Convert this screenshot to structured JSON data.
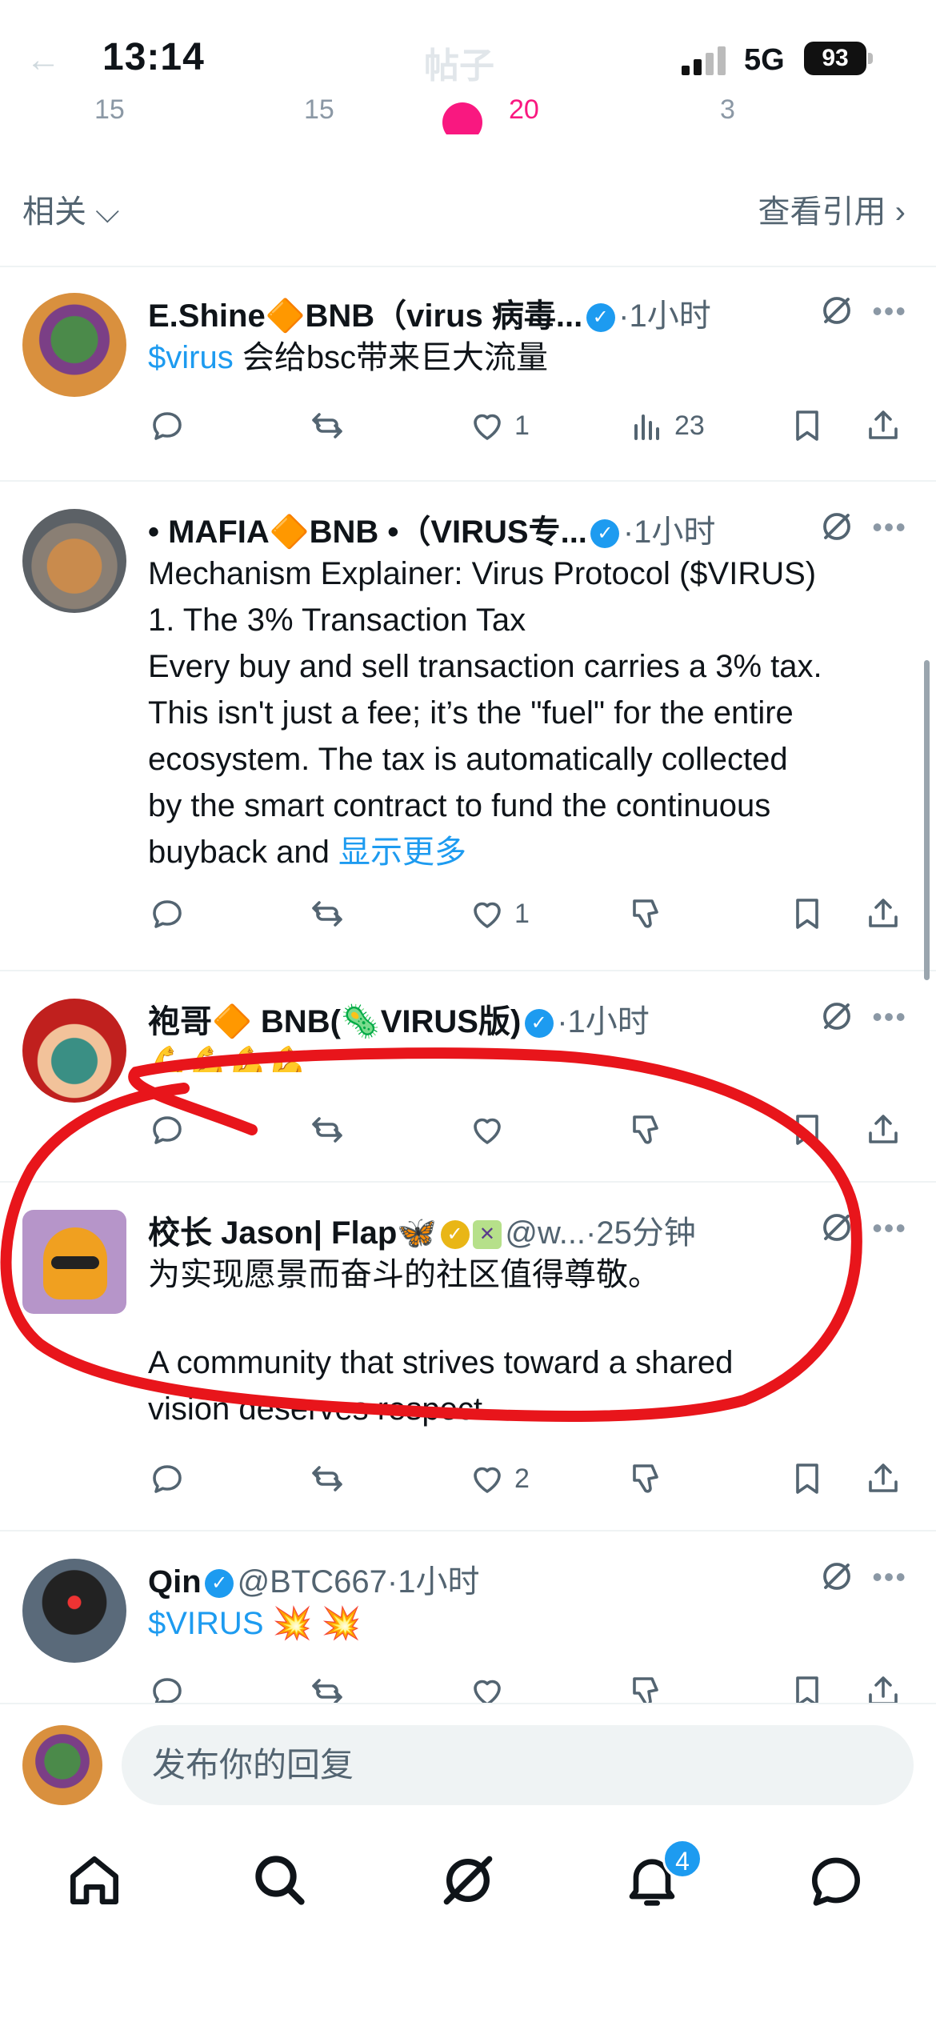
{
  "status_bar": {
    "time": "13:14",
    "network": "5G",
    "battery": "93",
    "title": "帖子",
    "back": "←"
  },
  "prev_actions": {
    "replies": "15",
    "retweets": "15",
    "likes": "20",
    "bookmarks": "3"
  },
  "related": {
    "label": "相关",
    "view_quotes": "查看引用"
  },
  "tweets": [
    {
      "name": "E.Shine🔶BNB（virus 病毒...",
      "handle": "",
      "time": "1小时",
      "body_link": "$virus",
      "body": " 会给bsc带来巨大流量",
      "replies": "",
      "retweets": "",
      "likes": "1",
      "views": "23"
    },
    {
      "name": "• MAFIA🔶BNB •（VIRUS专...",
      "handle": "",
      "time": "1小时",
      "lines": [
        "Mechanism Explainer: Virus Protocol ($VIRUS)",
        "1. The 3% Transaction Tax",
        "Every buy and sell transaction carries a 3% tax.",
        "This isn't just a fee; it’s the \"fuel\" for the entire",
        "ecosystem. The tax is automatically collected",
        "by the smart contract to fund the continuous"
      ],
      "last_line": "buyback and ",
      "show_more": "显示更多",
      "likes": "1"
    },
    {
      "name": "袍哥🔶 BNB(🦠VIRUS版)",
      "time": "1小时",
      "body": "💪💪💪💪",
      "likes": ""
    },
    {
      "name": "校长 Jason| Flap🦋",
      "handle": "@w...",
      "time": "25分钟",
      "line1": "为实现愿景而奋斗的社区值得尊敬。",
      "line2": "A community that strives toward a shared",
      "line3": "vision deserves respect.",
      "likes": "2"
    },
    {
      "name": "Qin",
      "handle": "@BTC667",
      "time": "1小时",
      "body_link": "$VIRUS",
      "body": " 💥 💥"
    }
  ],
  "reply": {
    "placeholder": "发布你的回复"
  },
  "nav": {
    "notifications_badge": "4"
  },
  "colors": {
    "accent": "#1d9bf0",
    "like": "#f91880",
    "annotation": "#e8151b",
    "verified_gold": "#e9b616"
  },
  "icons": [
    "reply-icon",
    "retweet-icon",
    "like-icon",
    "views-icon",
    "bookmark-icon",
    "share-icon",
    "grok-icon",
    "more-icon",
    "dislike-icon",
    "home-icon",
    "search-icon",
    "grok-nav-icon",
    "bell-icon",
    "messages-icon"
  ]
}
